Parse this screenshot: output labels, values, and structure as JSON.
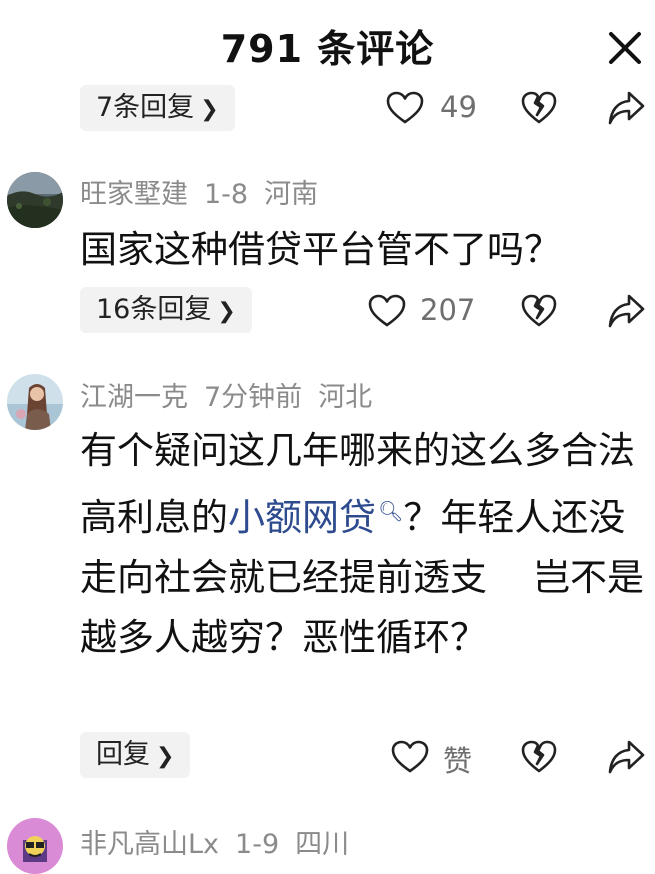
{
  "header": {
    "title": "791 条评论",
    "close_icon": "close-icon"
  },
  "comments": [
    {
      "reply_label": "7条回复",
      "like_count": "49"
    },
    {
      "avatar": "landscape-avatar",
      "username": "旺家墅建",
      "date": "1-8",
      "location": "河南",
      "text": "国家这种借贷平台管不了吗？",
      "reply_label": "16条回复",
      "like_count": "207"
    },
    {
      "avatar": "woman-avatar",
      "username": "江湖一克",
      "date": "7分钟前",
      "location": "河北",
      "text_before": "有个疑问这几年哪来的这么多合法高利息的",
      "link_text": "小额网贷",
      "link_icon": "search-icon",
      "text_line_end": "？年轻人还没走向社会就已经提前透支",
      "text_after": "岂不是越多人越穷？恶性循环？",
      "reply_label": "回复",
      "like_label": "赞"
    },
    {
      "avatar": "cartoon-avatar",
      "username": "非凡高山Lx",
      "date": "1-9",
      "location": "四川"
    }
  ],
  "icons": {
    "like": "heart-icon",
    "dislike": "broken-heart-icon",
    "share": "share-icon",
    "chevron": "chevron-right-icon"
  },
  "colors": {
    "text": "#111111",
    "meta": "#8b8b8b",
    "link": "#2d4b8e",
    "pill_bg": "#f2f2f2"
  }
}
